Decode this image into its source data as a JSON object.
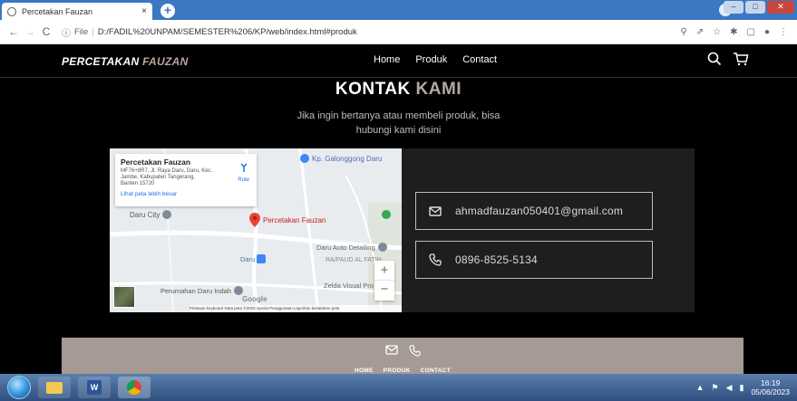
{
  "browser": {
    "tab_title": "Percetakan Fauzan",
    "tab_close": "×",
    "new_tab": "+",
    "nav": {
      "back": "←",
      "forward": "→",
      "reload": "C"
    },
    "address": {
      "info_icon": "ⓘ",
      "scheme_label": "File",
      "separator": "|",
      "url": "D:/FADIL%20UNPAM/SEMESTER%206/KP/web/index.html#produk"
    }
  },
  "site": {
    "brand_main": "PERCETAKAN",
    "brand_accent": "FAUZAN",
    "menu": {
      "home": "Home",
      "produk": "Produk",
      "contact": "Contact"
    },
    "section_title_main": "KONTAK",
    "section_title_accent": "KAMI",
    "subtitle_line1": "Jika ingin bertanya atau membeli produk, bisa",
    "subtitle_line2": "hubungi kami disini",
    "map": {
      "place_name": "Percetakan Fauzan",
      "address_line1": "MF76+8R7, Jl. Raya Daru, Daru, Kec.",
      "address_line2": "Jambe, Kabupaten Tangerang,",
      "address_line3": "Banten 15720",
      "route_label": "Rute",
      "view_larger": "Lihat peta lebih besar",
      "labels": {
        "kp_galonggong": "Kp. Galonggong Daru",
        "daru_city": "Daru City",
        "percetakan": "Percetakan Fauzan",
        "auto_detailing": "Daru Auto Detailing",
        "ra_paud": "RA/PAUD AL FATIH",
        "daru": "Daru",
        "perumahan": "Perumahan Daru Indah",
        "zelda": "Zelda Visual Pro",
        "google": "Google",
        "zoom_in": "+",
        "zoom_out": "−"
      },
      "attribution": "Pintasan keyboard   Data peta ©2023   Syarat Penggunaan   Laporkan kesalahan peta"
    },
    "contact_email": "ahmadfauzan050401@gmail.com",
    "contact_phone": "0896-8525-5134",
    "footer_links": {
      "home": "HOME",
      "produk": "PRODUK",
      "contact": "CONTACT"
    }
  },
  "taskbar": {
    "time": "16:19",
    "date": "05/06/2023"
  },
  "colors": {
    "accent": "#b6a8a0",
    "footer_bg": "#a69a94",
    "titlebar": "#3a78c2",
    "map_pin": "#ea4335"
  }
}
